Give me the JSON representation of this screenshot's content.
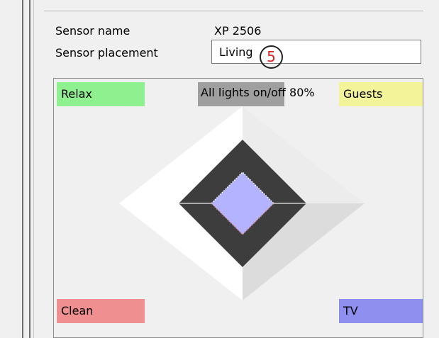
{
  "sensor": {
    "name_label": "Sensor name",
    "name_value": "XP 2506",
    "placement_label": "Sensor placement",
    "placement_value": "Living"
  },
  "badge": "5",
  "scenes": {
    "relax": "Relax",
    "all_lights": "All lights on/off 80%",
    "guests": "Guests",
    "clean": "Clean",
    "tv": "TV"
  },
  "colors": {
    "relax": "#8ff08f",
    "all_lights": "#9f9f9f",
    "guests": "#f3f39a",
    "clean": "#f08f8f",
    "tv": "#8f8ff0",
    "center_button": "#b3b3ff"
  }
}
